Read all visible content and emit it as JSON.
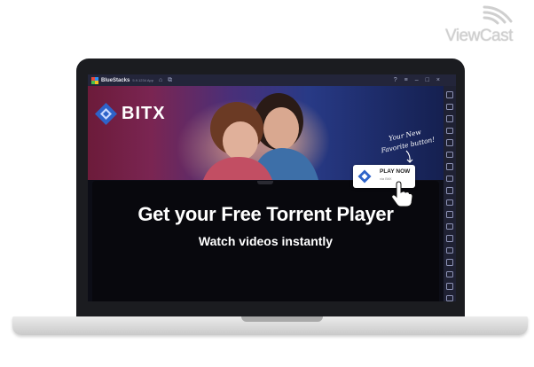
{
  "watermark": {
    "text": "ViewCast"
  },
  "window": {
    "app_title": "BlueStacks",
    "version_text": "5.9.1234 App",
    "buttons": {
      "help": "?",
      "menu": "≡",
      "minimize": "–",
      "maximize": "□",
      "close": "×"
    }
  },
  "app": {
    "brand": "BITX",
    "hint_line1": "Your New",
    "hint_line2": "Favorite button!",
    "play_button": {
      "label": "PLAY NOW",
      "sub": "via BitX"
    },
    "headline": "Get your Free Torrent Player",
    "subline": "Watch videos instantly"
  },
  "colors": {
    "titlebar": "#23253a",
    "sidebar": "#1f2133",
    "accent_blue": "#3a6fd8",
    "banner_left": "#6c1b3a",
    "banner_right": "#152050"
  }
}
